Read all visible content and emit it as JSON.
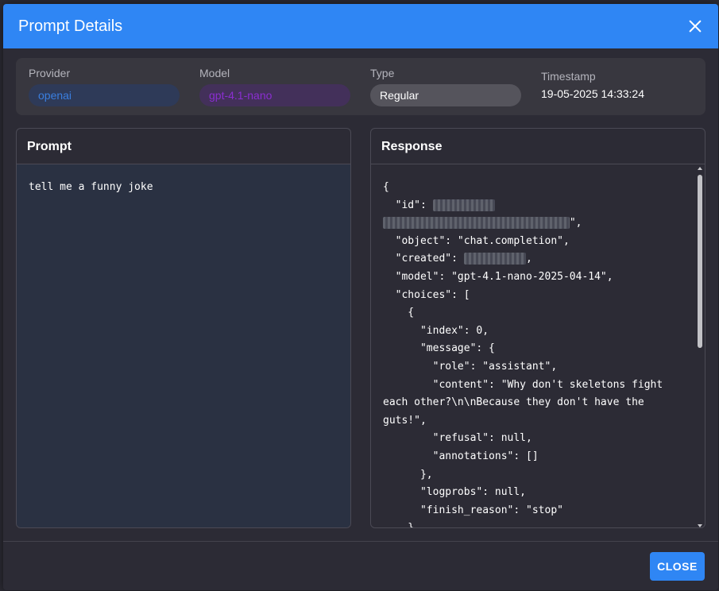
{
  "modal": {
    "title": "Prompt Details",
    "close_label": "CLOSE"
  },
  "meta": {
    "provider": {
      "label": "Provider",
      "value": "openai"
    },
    "model": {
      "label": "Model",
      "value": "gpt-4.1-nano"
    },
    "type": {
      "label": "Type",
      "value": "Regular"
    },
    "timestamp": {
      "label": "Timestamp",
      "value": "19-05-2025 14:33:24"
    }
  },
  "prompt": {
    "heading": "Prompt",
    "text": "tell me a funny joke"
  },
  "response": {
    "heading": "Response",
    "lines": [
      "{",
      "  \"id\": ",
      "",
      "  \"object\": \"chat.completion\",",
      "  \"created\": ",
      "  \"model\": \"gpt-4.1-nano-2025-04-14\",",
      "  \"choices\": [",
      "    {",
      "      \"index\": 0,",
      "      \"message\": {",
      "        \"role\": \"assistant\",",
      "        \"content\": \"Why don't skeletons fight",
      "each other?\\n\\nBecause they don't have the",
      "guts!\",",
      "        \"refusal\": null,",
      "        \"annotations\": []",
      "      },",
      "      \"logprobs\": null,",
      "      \"finish_reason\": \"stop\"",
      "    }"
    ]
  },
  "colors": {
    "accent": "#2f86f4",
    "provider_text": "#3a7fe0",
    "model_text": "#8a2ed0"
  }
}
